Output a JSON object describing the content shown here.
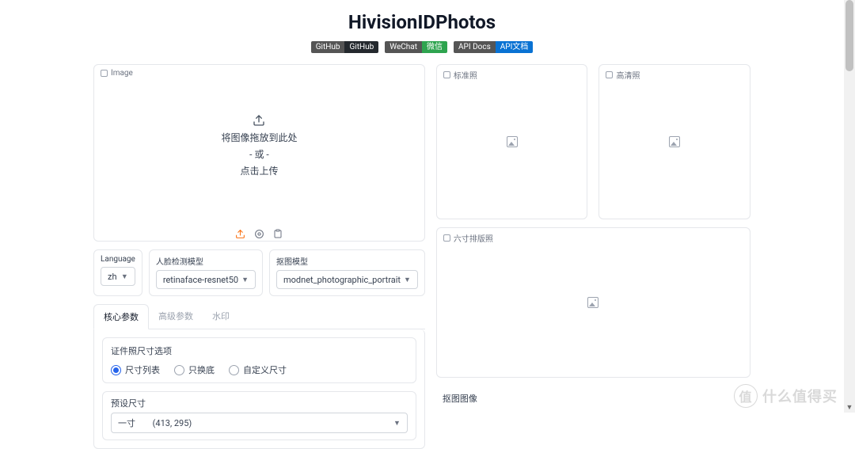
{
  "title": "HivisionIDPhotos",
  "badges": {
    "github": {
      "label": "GitHub",
      "value": "GitHub"
    },
    "wechat": {
      "label": "WeChat",
      "value": "微信"
    },
    "apidocs": {
      "label": "API Docs",
      "value": "API文档"
    }
  },
  "uploader": {
    "panel_label": "Image",
    "line1": "将图像拖放到此处",
    "line2": "- 或 -",
    "line3": "点击上传"
  },
  "outputs": {
    "standard": "标准照",
    "hd": "高清照",
    "layout6": "六寸排版照",
    "matte_section": "抠图图像"
  },
  "form": {
    "language": {
      "label": "Language",
      "value": "zh"
    },
    "face_model": {
      "label": "人脸检测模型",
      "value": "retinaface-resnet50"
    },
    "matting_model": {
      "label": "抠图模型",
      "value": "modnet_photographic_portrait"
    }
  },
  "tabs": [
    "核心参数",
    "高级参数",
    "水印"
  ],
  "size_options": {
    "group_title": "证件照尺寸选项",
    "opts": [
      "尺寸列表",
      "只换底",
      "自定义尺寸"
    ]
  },
  "preset": {
    "label": "预设尺寸",
    "value": "一寸\t(413, 295)"
  },
  "watermark_text": "什么值得买"
}
